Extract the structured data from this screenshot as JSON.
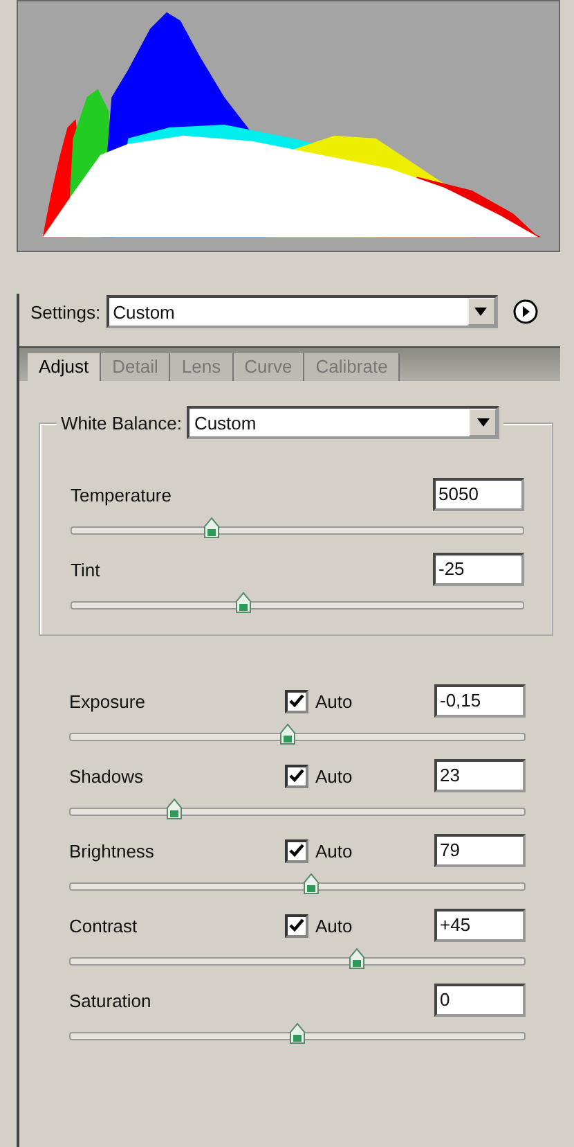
{
  "settings": {
    "label": "Settings:",
    "value": "Custom"
  },
  "tabs": [
    {
      "label": "Adjust",
      "selected": true
    },
    {
      "label": "Detail",
      "selected": false
    },
    {
      "label": "Lens",
      "selected": false
    },
    {
      "label": "Curve",
      "selected": false
    },
    {
      "label": "Calibrate",
      "selected": false
    }
  ],
  "white_balance": {
    "label": "White Balance:",
    "value": "Custom",
    "sliders": [
      {
        "name": "Temperature",
        "value": "5050",
        "level": 0.31
      },
      {
        "name": "Tint",
        "value": "-25",
        "level": 0.38
      }
    ]
  },
  "adjustments": [
    {
      "kind": "auto",
      "name": "Exposure",
      "auto_label": "Auto",
      "checked": true,
      "value": "-0,15",
      "level": 0.48
    },
    {
      "kind": "auto",
      "name": "Shadows",
      "auto_label": "Auto",
      "checked": true,
      "value": "23",
      "level": 0.23
    },
    {
      "kind": "auto",
      "name": "Brightness",
      "auto_label": "Auto",
      "checked": true,
      "value": "79",
      "level": 0.53
    },
    {
      "kind": "auto",
      "name": "Contrast",
      "auto_label": "Auto",
      "checked": true,
      "value": "+45",
      "level": 0.63
    },
    {
      "kind": "plain",
      "name": "Saturation",
      "value": "0",
      "level": 0.5
    }
  ]
}
